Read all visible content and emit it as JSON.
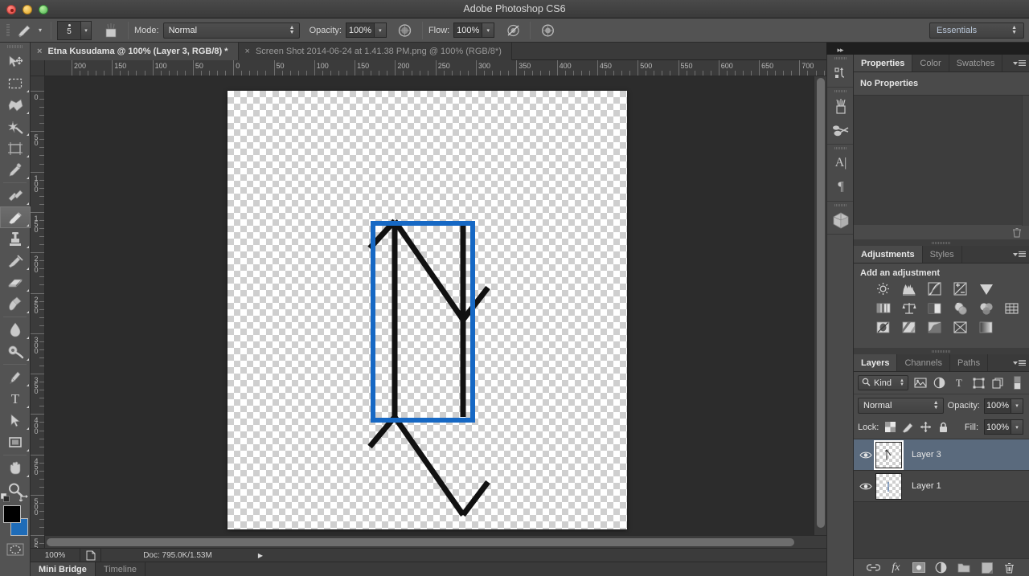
{
  "window": {
    "title": "Adobe Photoshop CS6",
    "traffic_lights": [
      "close",
      "minimize",
      "zoom"
    ]
  },
  "options_bar": {
    "tool_icon": "brush-icon",
    "brush_size": "5",
    "brush_preset_icon": "brush-preset-panel-icon",
    "mode_label": "Mode:",
    "mode_value": "Normal",
    "opacity_label": "Opacity:",
    "opacity_value": "100%",
    "airbrush_icon": "airbrush-icon",
    "flow_label": "Flow:",
    "flow_value": "100%",
    "tablet_pressure_opacity_icon": "pressure-opacity-icon",
    "tablet_pressure_size_icon": "pressure-size-icon",
    "workspace": "Essentials"
  },
  "tools": [
    {
      "name": "move-tool",
      "glyph": "move",
      "has_more": false,
      "active": false
    },
    {
      "name": "rectangular-marquee-tool",
      "glyph": "marquee",
      "has_more": true,
      "active": false
    },
    {
      "name": "lasso-tool",
      "glyph": "lasso",
      "has_more": true,
      "active": false
    },
    {
      "name": "quick-selection-tool",
      "glyph": "magicwand",
      "has_more": true,
      "active": false
    },
    {
      "name": "crop-tool",
      "glyph": "crop",
      "has_more": true,
      "active": false
    },
    {
      "name": "eyedropper-tool",
      "glyph": "eyedropper",
      "has_more": true,
      "active": false
    },
    {
      "name": "spot-healing-brush-tool",
      "glyph": "healing",
      "has_more": true,
      "active": false
    },
    {
      "name": "brush-tool",
      "glyph": "brush",
      "has_more": true,
      "active": true
    },
    {
      "name": "clone-stamp-tool",
      "glyph": "stamp",
      "has_more": true,
      "active": false
    },
    {
      "name": "history-brush-tool",
      "glyph": "historybrush",
      "has_more": true,
      "active": false
    },
    {
      "name": "eraser-tool",
      "glyph": "eraser",
      "has_more": true,
      "active": false
    },
    {
      "name": "gradient-tool",
      "glyph": "paintbucket",
      "has_more": true,
      "active": false
    },
    {
      "name": "blur-tool",
      "glyph": "blur",
      "has_more": true,
      "active": false
    },
    {
      "name": "dodge-tool",
      "glyph": "dodge",
      "has_more": true,
      "active": false
    },
    {
      "name": "pen-tool",
      "glyph": "pen",
      "has_more": true,
      "active": false
    },
    {
      "name": "horizontal-type-tool",
      "glyph": "type",
      "has_more": true,
      "active": false
    },
    {
      "name": "path-selection-tool",
      "glyph": "pathselect",
      "has_more": true,
      "active": false
    },
    {
      "name": "rectangle-tool",
      "glyph": "rectangle",
      "has_more": true,
      "active": false
    },
    {
      "name": "hand-tool",
      "glyph": "hand",
      "has_more": true,
      "active": false
    },
    {
      "name": "zoom-tool",
      "glyph": "zoom",
      "has_more": false,
      "active": false
    }
  ],
  "color_swatches": {
    "foreground": "#000000",
    "background": "#1f6cb8",
    "default_icon": "default-colors-icon",
    "swap_icon": "swap-colors-icon",
    "quickmask_icon": "quick-mask-icon"
  },
  "document_tabs": [
    {
      "label": "Etna Kusudama @ 100% (Layer 3, RGB/8) *",
      "active": true,
      "close_icon": "close-icon"
    },
    {
      "label": "Screen Shot 2014-06-24 at 1.41.38 PM.png @ 100% (RGB/8*)",
      "active": false,
      "close_icon": "close-icon"
    }
  ],
  "rulers": {
    "horizontal_labels": [
      "200",
      "150",
      "100",
      "50",
      "0",
      "50",
      "100",
      "150",
      "200",
      "250",
      "300",
      "350",
      "400",
      "450",
      "500",
      "550",
      "600",
      "650",
      "700"
    ],
    "vertical_labels": [
      "0",
      "50",
      "100",
      "150",
      "200",
      "250",
      "300",
      "350",
      "400",
      "450",
      "500",
      "550"
    ],
    "unit": "pixels"
  },
  "canvas": {
    "zoom": "100%",
    "transparent": true,
    "selection_rect_color": "#1668c4",
    "stroke_color": "#111111"
  },
  "status_bar": {
    "zoom": "100%",
    "thumbnail_icon": "document-thumb-icon",
    "doc_info": "Doc: 795.0K/1.53M",
    "expand_icon": "play-arrow-icon"
  },
  "bottom_tabs": [
    {
      "label": "Mini Bridge",
      "active": true
    },
    {
      "label": "Timeline",
      "active": false
    }
  ],
  "icon_dock": [
    {
      "name": "history-actions-icon",
      "glyph": "history"
    },
    {
      "name": "brush-panel-icon",
      "glyph": "brushpot"
    },
    {
      "name": "clone-source-icon",
      "glyph": "clonesource"
    },
    {
      "name": "character-panel-icon",
      "glyph": "character"
    },
    {
      "name": "paragraph-panel-icon",
      "glyph": "paragraph"
    },
    {
      "name": "3d-panel-icon",
      "glyph": "cube"
    }
  ],
  "collapse_icon": "collapse-panels-icon",
  "properties_panel": {
    "tabs": [
      {
        "label": "Properties",
        "active": true
      },
      {
        "label": "Color",
        "active": false
      },
      {
        "label": "Swatches",
        "active": false
      }
    ],
    "menu_icon": "panel-menu-icon",
    "empty_message": "No Properties",
    "footer_icons": [
      "delete-icon"
    ]
  },
  "adjustments_panel": {
    "tabs": [
      {
        "label": "Adjustments",
        "active": true
      },
      {
        "label": "Styles",
        "active": false
      }
    ],
    "menu_icon": "panel-menu-icon",
    "heading": "Add an adjustment",
    "rows": [
      [
        "brightness-contrast-icon",
        "levels-icon",
        "curves-icon",
        "exposure-icon",
        "vibrance-icon"
      ],
      [
        "hue-saturation-icon",
        "color-balance-icon",
        "black-white-icon",
        "photo-filter-icon",
        "channel-mixer-icon",
        "color-lookup-icon"
      ],
      [
        "invert-icon",
        "posterize-icon",
        "threshold-icon",
        "selective-color-icon",
        "gradient-map-icon"
      ]
    ]
  },
  "layers_panel": {
    "tabs": [
      {
        "label": "Layers",
        "active": true
      },
      {
        "label": "Channels",
        "active": false
      },
      {
        "label": "Paths",
        "active": false
      }
    ],
    "menu_icon": "panel-menu-icon",
    "filter": {
      "search_icon": "search-icon",
      "kind_label": "Kind",
      "type_filters": [
        "filter-pixel-icon",
        "filter-adjustment-icon",
        "filter-type-icon",
        "filter-shape-icon",
        "filter-smart-object-icon"
      ],
      "toggle_icon": "filter-toggle-icon"
    },
    "blend_mode": "Normal",
    "opacity_label": "Opacity:",
    "opacity_value": "100%",
    "lock_label": "Lock:",
    "lock_icons": [
      "lock-transparent-pixels-icon",
      "lock-image-pixels-icon",
      "lock-position-icon",
      "lock-all-icon"
    ],
    "fill_label": "Fill:",
    "fill_value": "100%",
    "layers": [
      {
        "name": "Layer 3",
        "visible": true,
        "selected": true,
        "eye_icon": "eye-icon"
      },
      {
        "name": "Layer 1",
        "visible": true,
        "selected": false,
        "eye_icon": "eye-icon"
      }
    ],
    "footer_icons": [
      "link-layers-icon",
      "layer-style-fx-icon",
      "add-layer-mask-icon",
      "new-adjustment-layer-icon",
      "new-group-icon",
      "new-layer-icon",
      "delete-layer-icon"
    ]
  }
}
